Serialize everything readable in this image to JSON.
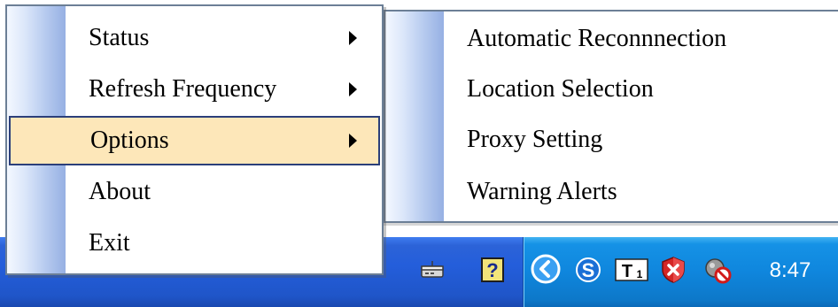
{
  "main_menu": {
    "items": [
      {
        "label": "Status",
        "has_submenu": true
      },
      {
        "label": "Refresh Frequency",
        "has_submenu": true
      },
      {
        "label": "Options",
        "has_submenu": true,
        "highlighted": true
      },
      {
        "label": "About",
        "has_submenu": false
      },
      {
        "label": "Exit",
        "has_submenu": false
      }
    ]
  },
  "sub_menu": {
    "parent": "Options",
    "items": [
      {
        "label": "Automatic Reconnnection"
      },
      {
        "label": "Location Selection"
      },
      {
        "label": "Proxy Setting"
      },
      {
        "label": "Warning Alerts"
      }
    ]
  },
  "taskbar": {
    "tray_icons": [
      "network-icon",
      "help-icon",
      "show-hidden-icons-button",
      "sync-icon",
      "t1-icon",
      "security-shield-icon",
      "disconnected-icon"
    ],
    "clock": "8:47"
  },
  "colors": {
    "highlight_bg": "#fde7b9",
    "highlight_border": "#2b3f7a",
    "taskbar_blue": "#245edb",
    "tray_blue": "#0f86dd"
  }
}
